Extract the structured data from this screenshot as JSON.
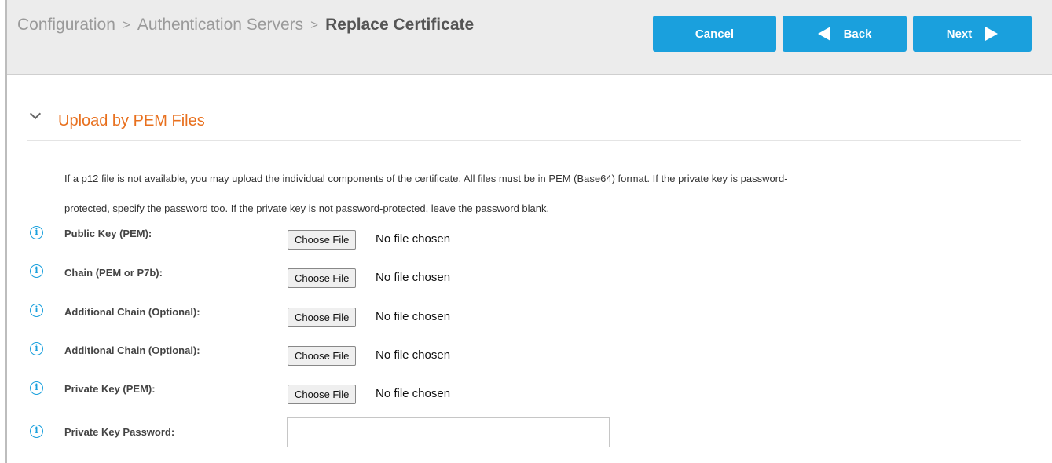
{
  "breadcrumb": {
    "items": [
      "Configuration",
      "Authentication Servers"
    ],
    "separator": ">",
    "current": "Replace Certificate"
  },
  "actions": {
    "cancel_label": "Cancel",
    "back_label": "Back",
    "next_label": "Next"
  },
  "section": {
    "title": "Upload by PEM Files",
    "description_line1": "If a p12 file is not available, you may upload the individual components of the certificate. All files must be in PEM (Base64) format. If the private key is password-",
    "description_line2": "protected, specify the password too. If the private key is not password-protected, leave the password blank."
  },
  "fields": [
    {
      "label": "Public Key (PEM):",
      "button": "Choose File",
      "status": "No file chosen"
    },
    {
      "label": "Chain (PEM or P7b):",
      "button": "Choose File",
      "status": "No file chosen"
    },
    {
      "label": "Additional Chain (Optional):",
      "button": "Choose File",
      "status": "No file chosen"
    },
    {
      "label": "Additional Chain (Optional):",
      "button": "Choose File",
      "status": "No file chosen"
    },
    {
      "label": "Private Key (PEM):",
      "button": "Choose File",
      "status": "No file chosen"
    }
  ],
  "password_field": {
    "label": "Private Key Password:",
    "value": ""
  },
  "icons": {
    "info": "info-icon",
    "collapse": "chevron-down-icon"
  },
  "colors": {
    "accent": "#1aa0dd",
    "section_title": "#e8701e",
    "header_bg": "#ececec"
  }
}
